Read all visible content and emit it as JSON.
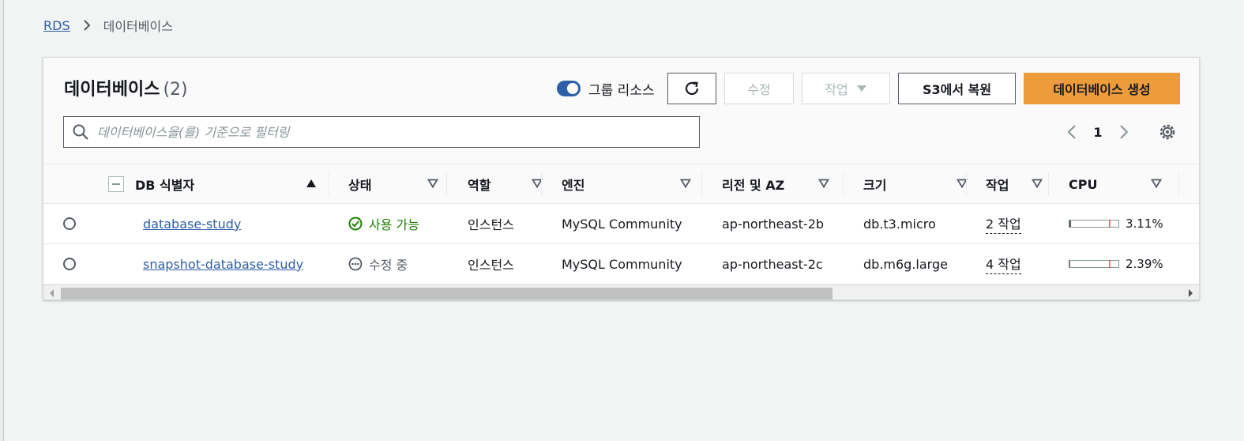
{
  "breadcrumb": {
    "root": "RDS",
    "current": "데이터베이스"
  },
  "panel": {
    "title": "데이터베이스",
    "count": "(2)",
    "toggle_label": "그룹 리소스",
    "buttons": {
      "modify": "수정",
      "actions": "작업",
      "restore_s3": "S3에서 복원",
      "create": "데이터베이스 생성"
    },
    "search_placeholder": "데이터베이스을(를) 기준으로 필터링",
    "page_number": "1"
  },
  "table": {
    "headers": {
      "id": "DB 식별자",
      "status": "상태",
      "role": "역할",
      "engine": "엔진",
      "region": "리전 및 AZ",
      "size": "크기",
      "actions": "작업",
      "cpu": "CPU"
    },
    "rows": [
      {
        "id": "database-study",
        "status": "사용 가능",
        "status_kind": "available",
        "role": "인스턴스",
        "engine": "MySQL Community",
        "region": "ap-northeast-2b",
        "size": "db.t3.micro",
        "actions": "2 작업",
        "cpu": "3.11%",
        "cpu_value": 3.11
      },
      {
        "id": "snapshot-database-study",
        "status": "수정 중",
        "status_kind": "modifying",
        "role": "인스턴스",
        "engine": "MySQL Community",
        "region": "ap-northeast-2c",
        "size": "db.m6g.large",
        "actions": "4 작업",
        "cpu": "2.39%",
        "cpu_value": 2.39
      }
    ]
  },
  "colors": {
    "accent": "#2d5ea8",
    "primary_button": "#ec9c3b",
    "status_ok": "#1d8102"
  }
}
